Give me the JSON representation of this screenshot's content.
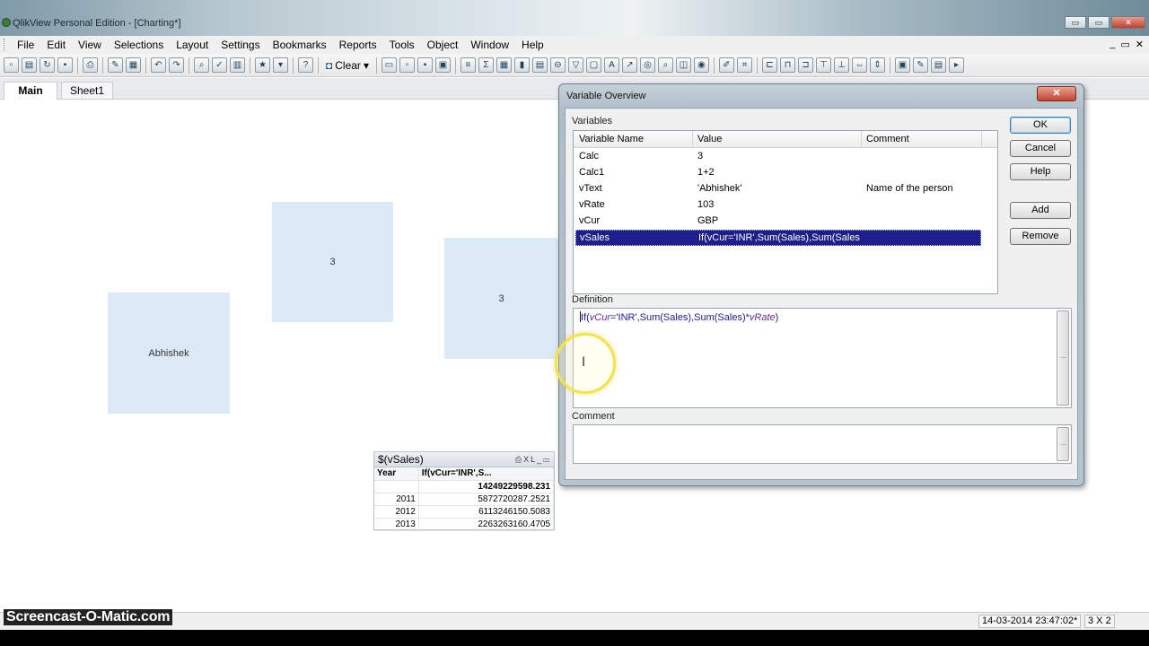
{
  "window": {
    "title": "QlikView Personal Edition - [Charting*]",
    "buttons": [
      "▭",
      "▭",
      "✕"
    ]
  },
  "menubar": {
    "items": [
      "File",
      "Edit",
      "View",
      "Selections",
      "Layout",
      "Settings",
      "Bookmarks",
      "Reports",
      "Tools",
      "Object",
      "Window",
      "Help"
    ],
    "mdi": [
      "_",
      "▭",
      "✕"
    ]
  },
  "toolbar": {
    "clear_label": "Clear"
  },
  "tabs": {
    "main": "Main",
    "sheet1": "Sheet1"
  },
  "sheet": {
    "text_objects": [
      {
        "label": "Abhishek"
      },
      {
        "label": "3"
      },
      {
        "label": "3"
      }
    ],
    "straight_table": {
      "caption": "$(vSales)",
      "columns": [
        "Year",
        "If(vCur='INR',S..."
      ],
      "total": "14249229598.231",
      "rows": [
        {
          "year": "2011",
          "value": "5872720287.2521"
        },
        {
          "year": "2012",
          "value": "6113246150.5083"
        },
        {
          "year": "2013",
          "value": "2263263160.4705"
        }
      ]
    }
  },
  "dialog": {
    "title": "Variable Overview",
    "close": "✕",
    "variables_label": "Variables",
    "columns": [
      "Variable Name",
      "Value",
      "Comment"
    ],
    "variables": [
      {
        "name": "Calc",
        "value": "3",
        "comment": ""
      },
      {
        "name": "Calc1",
        "value": "1+2",
        "comment": ""
      },
      {
        "name": "vText",
        "value": "'Abhishek'",
        "comment": "Name of the person"
      },
      {
        "name": "vRate",
        "value": "103",
        "comment": ""
      },
      {
        "name": "vCur",
        "value": "GBP",
        "comment": ""
      },
      {
        "name": "vSales",
        "value": "If(vCur='INR',Sum(Sales),Sum(Sales)*vR",
        "comment": ""
      }
    ],
    "selected_index": 5,
    "definition_label": "Definition",
    "definition": {
      "p1": "If(",
      "p2": "vCur",
      "p3": "='INR',Sum(Sales),Sum(Sales)*",
      "p4": "vRate",
      "p5": ")"
    },
    "comment_label": "Comment",
    "buttons": {
      "ok": "OK",
      "cancel": "Cancel",
      "help": "Help",
      "add": "Add",
      "remove": "Remove"
    },
    "scroll_grip": "..."
  },
  "statusbar": {
    "timestamp": "14-03-2014 23:47:02*",
    "dims": "3 X 2"
  },
  "watermark": "Screencast-O-Matic.com"
}
